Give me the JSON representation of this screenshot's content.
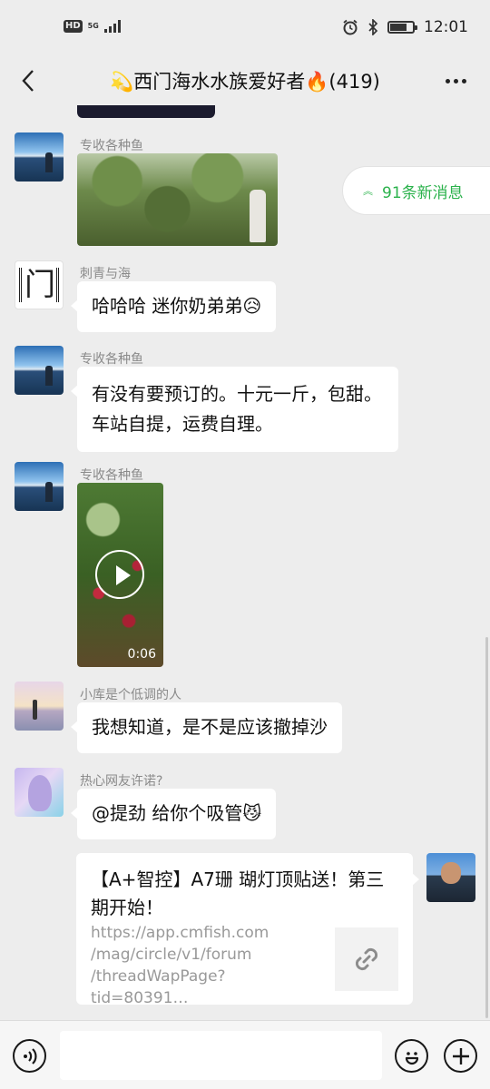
{
  "status_bar": {
    "time": "12:01",
    "hd": "HD",
    "net": "5G"
  },
  "header": {
    "title": "💫西门海水水族爱好者🔥(419)"
  },
  "new_messages": {
    "label": "91条新消息"
  },
  "messages": [
    {
      "sender": "专收各种鱼",
      "type": "image"
    },
    {
      "sender": "刺青与海",
      "text": "哈哈哈 迷你奶弟弟😥"
    },
    {
      "sender": "专收各种鱼",
      "text": "有没有要预订的。十元一斤，包甜。车站自提，运费自理。"
    },
    {
      "sender": "专收各种鱼",
      "type": "video",
      "duration": "0:06"
    },
    {
      "sender": "小库是个低调的人",
      "text": "我想知道，是不是应该撤掉沙"
    },
    {
      "sender": "热心网友许诺?",
      "text": "@提劲  给你个吸管😼"
    },
    {
      "type": "link",
      "title": "【A+智控】A7珊 瑚灯顶贴送！第三期开始！",
      "url": "https://app.cmfish.com /mag/circle/v1/forum /threadWapPage?tid=80391…"
    }
  ],
  "logo_text": "门",
  "colors": {
    "accent_green": "#2bb24c",
    "background": "#ededed"
  }
}
